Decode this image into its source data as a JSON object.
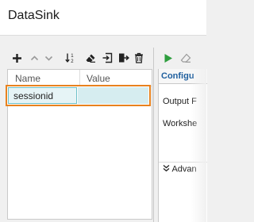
{
  "window": {
    "title": "DataSink"
  },
  "toolbar": {
    "buttons": [
      {
        "name": "add-icon",
        "title": "Add"
      },
      {
        "name": "move-up-icon",
        "title": "Move up"
      },
      {
        "name": "move-down-icon",
        "title": "Move down"
      },
      {
        "name": "sort-icon",
        "title": "Sort"
      },
      {
        "name": "eraser-icon",
        "title": "Clear"
      },
      {
        "name": "import-icon",
        "title": "Import"
      },
      {
        "name": "export-icon",
        "title": "Export"
      },
      {
        "name": "trash-icon",
        "title": "Delete"
      }
    ]
  },
  "table": {
    "columns": [
      "Name",
      "Value"
    ],
    "rows": [
      {
        "name": "sessionid",
        "value": ""
      }
    ]
  },
  "right_panel": {
    "tab_label": "Configu",
    "fields": [
      "Output F",
      "Workshe"
    ],
    "advanced_label": "Advan"
  },
  "colors": {
    "selection": "#e8821f",
    "accent": "#1f5f9e",
    "run": "#2e9e3e"
  }
}
